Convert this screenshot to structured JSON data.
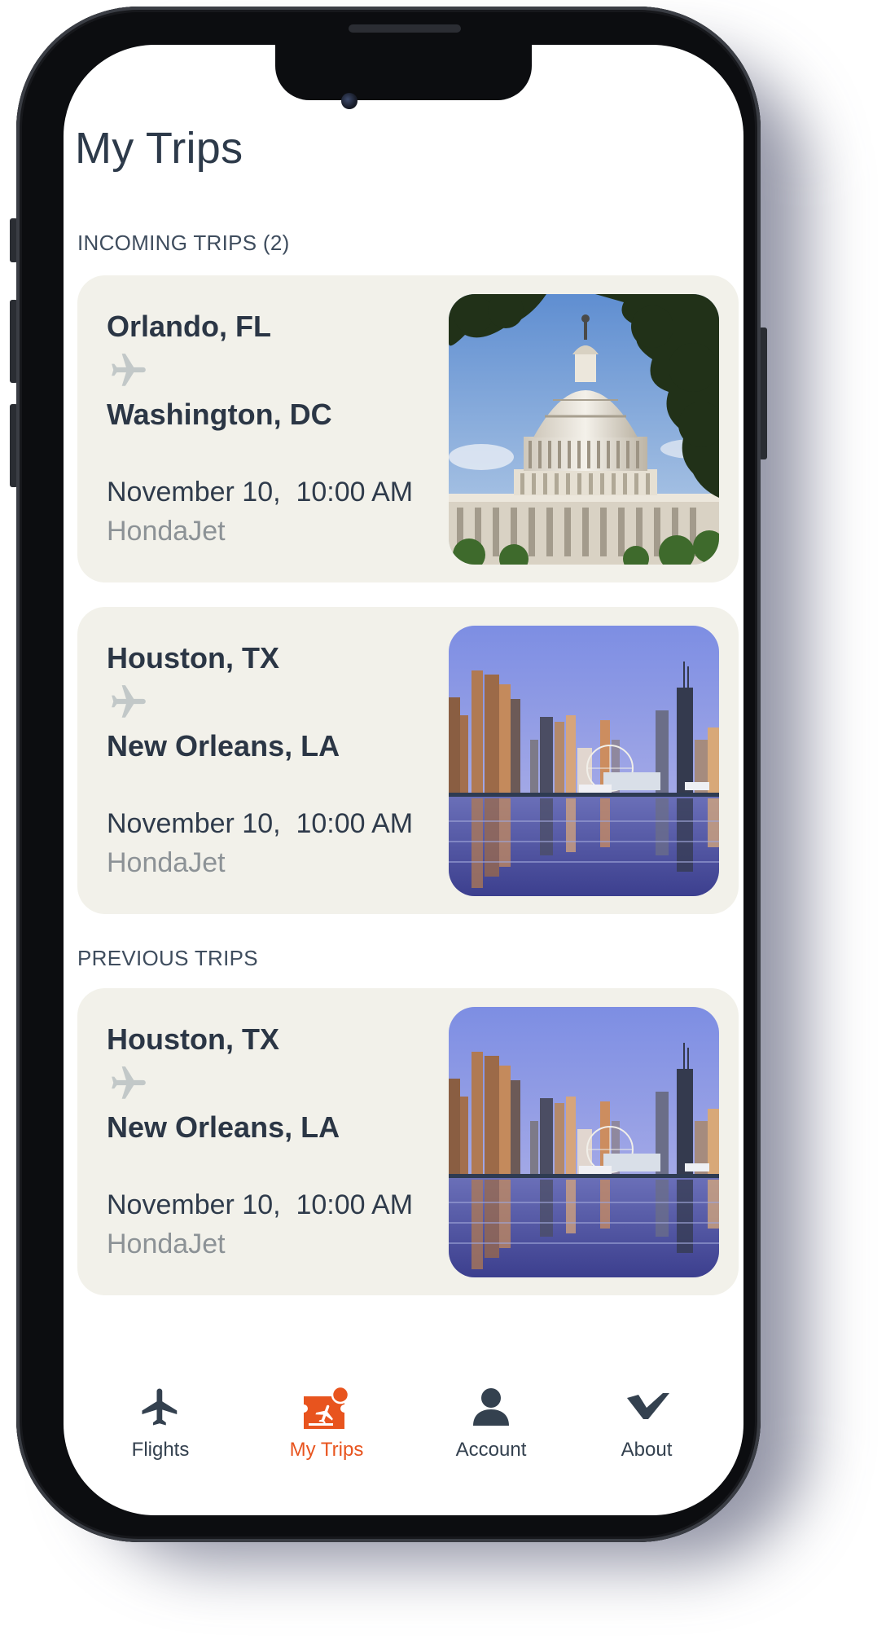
{
  "screen": {
    "title": "My Trips"
  },
  "sections": {
    "incoming_label": "INCOMING TRIPS (2)",
    "previous_label": "PREVIOUS TRIPS"
  },
  "trips": [
    {
      "from": "Orlando, FL",
      "to": "Washington, DC",
      "datetime": "November 10,  10:00 AM",
      "aircraft": "HondaJet",
      "photo": "capitol-building"
    },
    {
      "from": "Houston, TX",
      "to": "New Orleans, LA",
      "datetime": "November 10,  10:00 AM",
      "aircraft": "HondaJet",
      "photo": "city-skyline-waterfront"
    },
    {
      "from": "Houston, TX",
      "to": "New Orleans, LA",
      "datetime": "November 10,  10:00 AM",
      "aircraft": "HondaJet",
      "photo": "city-skyline-waterfront"
    }
  ],
  "tab_bar": {
    "tabs": [
      {
        "label": "Flights",
        "icon": "airplane-icon",
        "active": false
      },
      {
        "label": "My Trips",
        "icon": "ticket-icon",
        "active": true,
        "badge": "1"
      },
      {
        "label": "Account",
        "icon": "person-icon",
        "active": false
      },
      {
        "label": "About",
        "icon": "logo-icon",
        "active": false
      }
    ]
  },
  "colors": {
    "accent": "#e8541e",
    "text_dark": "#2b3645",
    "card_background": "#f2f1ea",
    "muted_text": "#8c9296",
    "plane_icon": "#c2c8c8"
  }
}
